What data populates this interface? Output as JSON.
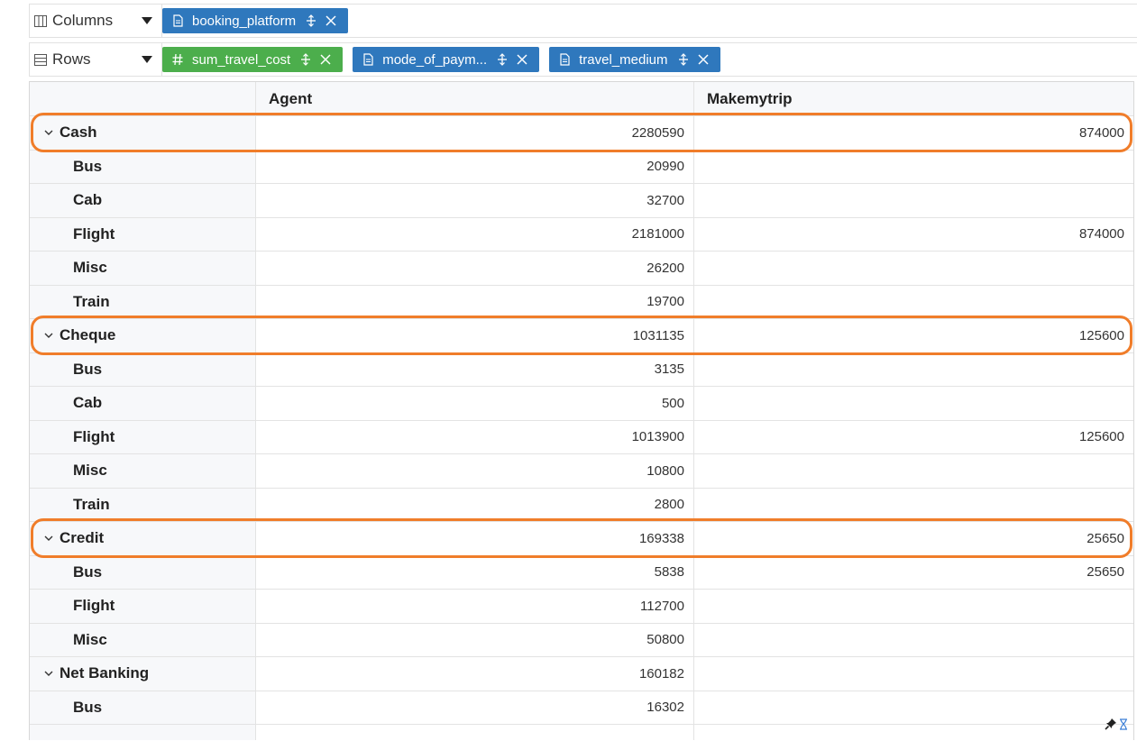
{
  "columns_shelf": {
    "label": "Columns",
    "pills": [
      {
        "label": "booking_platform",
        "type": "dimension",
        "color": "#2f78bd"
      }
    ]
  },
  "rows_shelf": {
    "label": "Rows",
    "pills": [
      {
        "label": "sum_travel_cost",
        "type": "measure",
        "color": "#4cae4c"
      },
      {
        "label": "mode_of_paym...",
        "type": "dimension",
        "color": "#2f78bd"
      },
      {
        "label": "travel_medium",
        "type": "dimension",
        "color": "#2f78bd"
      }
    ]
  },
  "table": {
    "columns": [
      "Agent",
      "Makemytrip"
    ],
    "groups": [
      {
        "label": "Cash",
        "agent": "2280590",
        "makemytrip": "874000",
        "highlighted": true,
        "children": [
          {
            "label": "Bus",
            "agent": "20990",
            "makemytrip": ""
          },
          {
            "label": "Cab",
            "agent": "32700",
            "makemytrip": ""
          },
          {
            "label": "Flight",
            "agent": "2181000",
            "makemytrip": "874000"
          },
          {
            "label": "Misc",
            "agent": "26200",
            "makemytrip": ""
          },
          {
            "label": "Train",
            "agent": "19700",
            "makemytrip": ""
          }
        ]
      },
      {
        "label": "Cheque",
        "agent": "1031135",
        "makemytrip": "125600",
        "highlighted": true,
        "children": [
          {
            "label": "Bus",
            "agent": "3135",
            "makemytrip": ""
          },
          {
            "label": "Cab",
            "agent": "500",
            "makemytrip": ""
          },
          {
            "label": "Flight",
            "agent": "1013900",
            "makemytrip": "125600"
          },
          {
            "label": "Misc",
            "agent": "10800",
            "makemytrip": ""
          },
          {
            "label": "Train",
            "agent": "2800",
            "makemytrip": ""
          }
        ]
      },
      {
        "label": "Credit",
        "agent": "169338",
        "makemytrip": "25650",
        "highlighted": true,
        "children": [
          {
            "label": "Bus",
            "agent": "5838",
            "makemytrip": "25650"
          },
          {
            "label": "Flight",
            "agent": "112700",
            "makemytrip": ""
          },
          {
            "label": "Misc",
            "agent": "50800",
            "makemytrip": ""
          }
        ]
      },
      {
        "label": "Net Banking",
        "agent": "160182",
        "makemytrip": "",
        "highlighted": false,
        "children": [
          {
            "label": "Bus",
            "agent": "16302",
            "makemytrip": ""
          }
        ]
      }
    ]
  },
  "colors": {
    "highlight": "#f07d2a",
    "dimension_pill": "#2f78bd",
    "measure_pill": "#4cae4c"
  },
  "icons": {
    "columns_shelf": "columns-icon",
    "rows_shelf": "rows-icon",
    "dimension_pill": "document-icon",
    "measure_pill": "hash-icon",
    "pill_sort": "sort-icon",
    "pill_remove": "close-icon",
    "group_expand": "chevron-down-icon",
    "corner": [
      "pin-icon",
      "hourglass-icon"
    ]
  }
}
